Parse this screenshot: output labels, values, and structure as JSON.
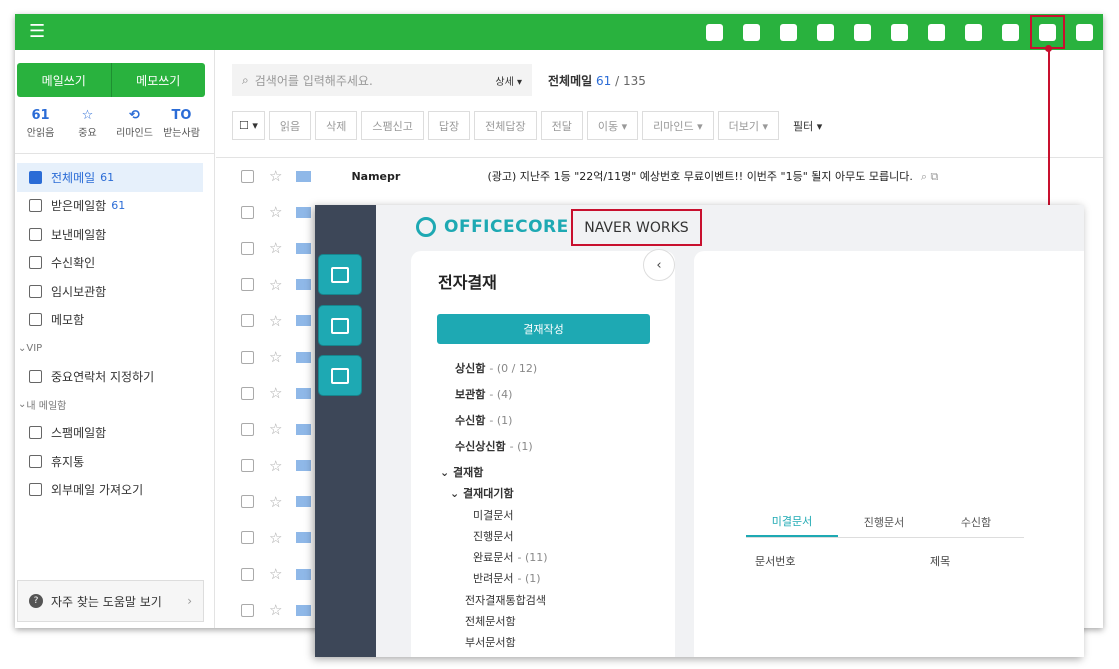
{
  "topbar": {
    "menu_icon": "hamburger-icon",
    "icons": [
      "memo-icon",
      "chat-icon",
      "mail-icon",
      "calendar-icon",
      "contacts-icon",
      "cloud-icon",
      "task-icon",
      "approval-icon",
      "home-icon",
      "write-icon",
      "whale-icon"
    ],
    "selected_icon": "write-icon"
  },
  "sidebar": {
    "write_mail": "메일쓰기",
    "write_memo": "메모쓰기",
    "quick": [
      {
        "value": "61",
        "label": "안읽음"
      },
      {
        "icon": "☆",
        "label": "중요"
      },
      {
        "icon": "⟲",
        "label": "리마인드"
      },
      {
        "icon": "TO",
        "label": "받는사람"
      }
    ],
    "folders": [
      {
        "label": "전체메일",
        "count": "61",
        "active": true
      },
      {
        "label": "받은메일함",
        "count": "61"
      },
      {
        "label": "보낸메일함"
      },
      {
        "label": "수신확인"
      },
      {
        "label": "임시보관함"
      },
      {
        "label": "메모함"
      }
    ],
    "vip_section": "VIP",
    "vip_add": "중요연락처 지정하기",
    "my_section": "내 메일함",
    "my_folders": [
      "스팸메일함",
      "휴지통",
      "외부메일 가져오기"
    ],
    "help": "자주 찾는 도움말 보기"
  },
  "main": {
    "search_placeholder": "검색어를 입력해주세요.",
    "search_option": "상세 ▾",
    "title": "전체메일",
    "unread": "61",
    "total": "135",
    "toolbar": [
      "읽음",
      "삭제",
      "스팸신고",
      "답장",
      "전체답장",
      "전달",
      "이동 ▾",
      "리마인드 ▾",
      "더보기 ▾"
    ],
    "filter": "필터 ▾",
    "mails": [
      {
        "from": "Namepr",
        "subject": "(광고) 지난주 1등 \"22억/11명\" 예상번호 무료이벤트!! 이번주 \"1등\" 될지 아무도 모릅니다.",
        "tools": "⌕ ⧉"
      },
      {
        "from": "",
        "subject": ""
      },
      {
        "from": "",
        "subject": ""
      },
      {
        "from": "",
        "subject": ""
      },
      {
        "from": "",
        "subject": ""
      },
      {
        "from": "",
        "subject": ""
      },
      {
        "from": "",
        "subject": ""
      },
      {
        "from": "",
        "subject": ""
      },
      {
        "from": "",
        "subject": ""
      },
      {
        "from": "",
        "subject": ""
      },
      {
        "from": "",
        "subject": ""
      },
      {
        "from": "",
        "subject": ""
      },
      {
        "from": "",
        "subject": ""
      }
    ]
  },
  "overlay": {
    "logo": "OFFICECORE",
    "naver": "NAVER WORKS",
    "collapse": "‹",
    "panel_title": "전자결재",
    "write_btn": "결재작성",
    "tree": [
      {
        "label": "상신함",
        "count": "- (0 / 12)",
        "level": 0,
        "bold": true
      },
      {
        "label": "보관함",
        "count": "- (4)",
        "level": 0,
        "bold": true
      },
      {
        "label": "수신함",
        "count": "- (1)",
        "level": 0,
        "bold": true
      },
      {
        "label": "수신상신함",
        "count": "- (1)",
        "level": 0,
        "bold": true
      },
      {
        "label": "⌄ 결재함",
        "count": "",
        "level": 0,
        "bold": true
      },
      {
        "label": "⌄ 결재대기함",
        "count": "",
        "level": 1,
        "bold": true
      },
      {
        "label": "미결문서",
        "count": "",
        "level": 2
      },
      {
        "label": "진행문서",
        "count": "",
        "level": 2
      },
      {
        "label": "완료문서",
        "count": "- (11)",
        "level": 2
      },
      {
        "label": "반려문서",
        "count": "- (1)",
        "level": 2
      },
      {
        "label": "전자결재통합검색",
        "count": "",
        "level": 1
      },
      {
        "label": "전체문서함",
        "count": "",
        "level": 1
      },
      {
        "label": "부서문서함",
        "count": "",
        "level": 1
      }
    ],
    "tabs": [
      "미결문서",
      "진행문서",
      "수신함"
    ],
    "columns": [
      "문서번호",
      "제목"
    ],
    "rail_icons": [
      "edit-doc-icon",
      "briefcase-icon",
      "phonebook-icon"
    ]
  },
  "colors": {
    "green": "#29b23e",
    "teal": "#1ea9b3",
    "blue": "#2b6cd6",
    "red": "#c8102e"
  }
}
